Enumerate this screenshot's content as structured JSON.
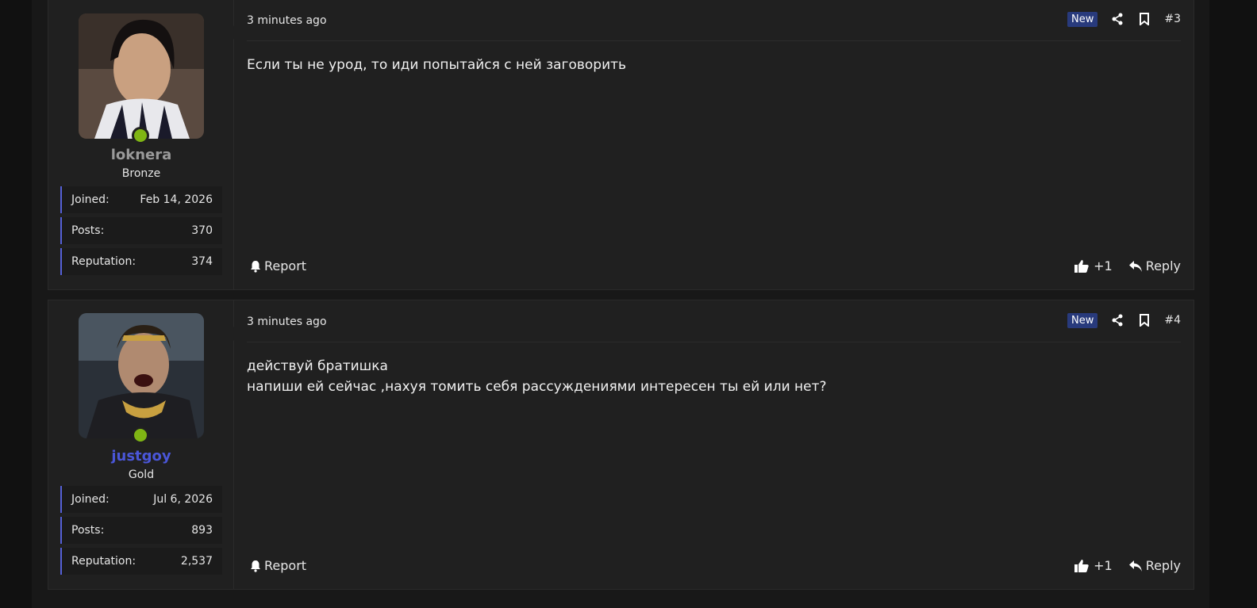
{
  "posts": [
    {
      "username": "loknera",
      "user_title": "Bronze",
      "username_color": "#9a9a9a",
      "stats": [
        {
          "label": "Joined:",
          "value": "Feb 14, 2026"
        },
        {
          "label": "Posts:",
          "value": "370"
        },
        {
          "label": "Reputation:",
          "value": "374"
        }
      ],
      "timestamp": "3 minutes ago",
      "badge": "New",
      "post_number": "#3",
      "message": "Если ты не урод, то иди попытайся с ней заговорить",
      "report_label": "Report",
      "reaction_count": "+1",
      "reply_label": "Reply"
    },
    {
      "username": "justgoy",
      "user_title": "Gold",
      "username_color": "#4a56d8",
      "stats": [
        {
          "label": "Joined:",
          "value": "Jul 6, 2026"
        },
        {
          "label": "Posts:",
          "value": "893"
        },
        {
          "label": "Reputation:",
          "value": "2,537"
        }
      ],
      "timestamp": "3 minutes ago",
      "badge": "New",
      "post_number": "#4",
      "message": "действуй братишка\nнапиши ей сейчас ,нахуя томить себя рассуждениями интересен ты ей или нет?",
      "report_label": "Report",
      "reaction_count": "+1",
      "reply_label": "Reply"
    }
  ],
  "colors": {
    "accent": "#5560d6",
    "online": "#7fb514",
    "badge_bg": "#283a7c"
  },
  "icons": [
    "share-icon",
    "bookmark-icon",
    "bell-icon",
    "thumbs-up-icon",
    "reply-arrow-icon"
  ]
}
